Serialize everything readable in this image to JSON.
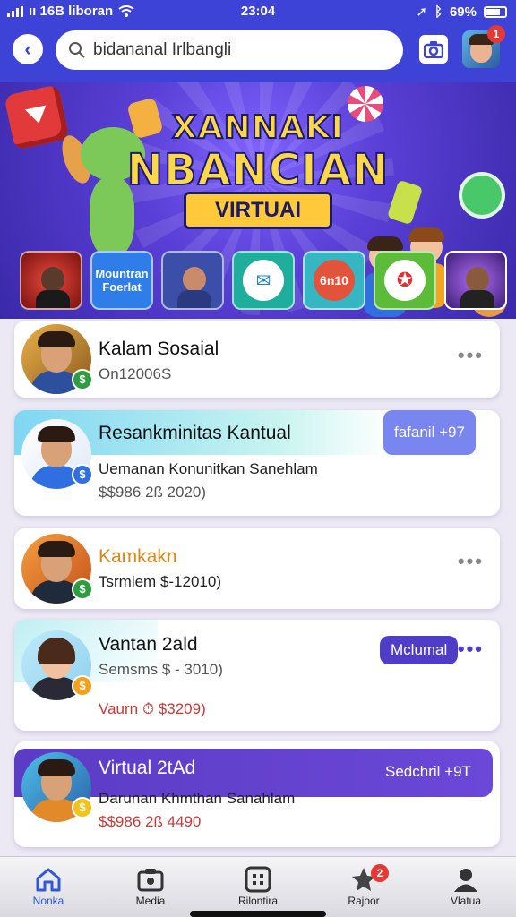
{
  "status": {
    "carrier": "ıı 16B liboran",
    "time": "23:04",
    "battery": "69%"
  },
  "header": {
    "search_value": "bidananal Irlbangli",
    "avatar_badge": "1"
  },
  "banner": {
    "title_line1": "XANNAKI",
    "title_line2": "NBANCIAN",
    "ribbon": "VIRTUAI"
  },
  "thumbs": [
    {
      "label": ""
    },
    {
      "label": "Mountran Foerlat"
    },
    {
      "label": ""
    },
    {
      "label": ""
    },
    {
      "label": "6n10"
    },
    {
      "label": ""
    },
    {
      "label": ""
    }
  ],
  "items": [
    {
      "name": "Kalam Sosaial",
      "line1": "On12006S",
      "line2": "",
      "badge": "",
      "coin": "$"
    },
    {
      "name": "Resankminitas  Kantual",
      "line1": "Uemanan Konunitkan Sanehlam",
      "line2": "$$986 2ß 2020)",
      "badge": "fafanil  +97",
      "coin": "$"
    },
    {
      "name": "Kamkakn",
      "line1": "Tsrmlem $-12010)",
      "line2": "",
      "badge": "",
      "coin": "$"
    },
    {
      "name": "Vantan 2ald",
      "line1": "Semsms $ - 3010)",
      "line2": "Vaurn  ⏱  $3209)",
      "badge": "Mclumal",
      "coin": "$"
    },
    {
      "name": "Virtual 2tAd",
      "line1": "Darunan Khmthan Sanahlam",
      "line2": "$$986 2ß 4490",
      "badge": "Sedchril  +9T",
      "coin": "$"
    }
  ],
  "nav": [
    {
      "label": "Nonka"
    },
    {
      "label": "Media"
    },
    {
      "label": "Rilontira"
    },
    {
      "label": "Rajoor",
      "badge": "2"
    },
    {
      "label": "Vlatua"
    }
  ],
  "colors": {
    "primary": "#3e43d8",
    "purple": "#5b3cc4",
    "accent_green": "#2e9c41",
    "accent_blue": "#2f6fe0",
    "accent_orange": "#f2a01e"
  }
}
